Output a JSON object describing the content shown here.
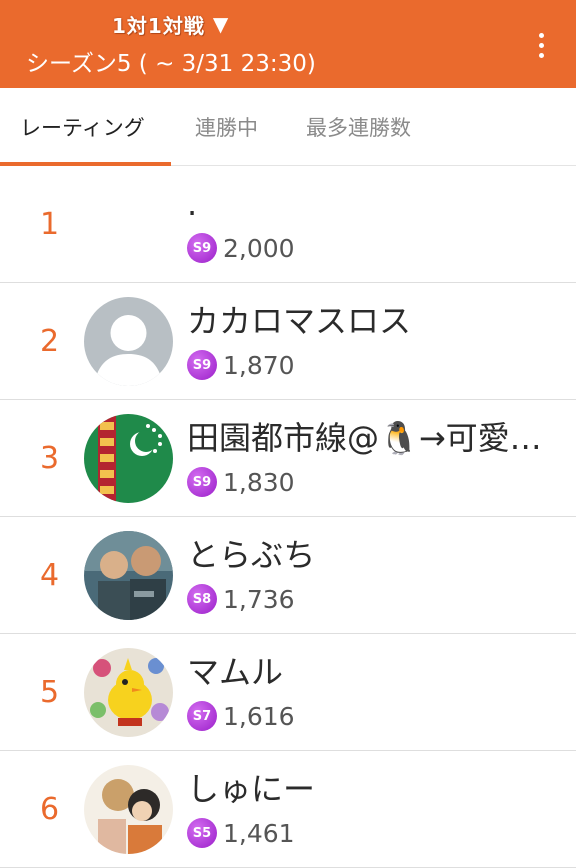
{
  "header": {
    "mode_label": "1対1対戦",
    "mode_caret": "▼",
    "season_label": "シーズン5 ( ~ 3/31 23:30)"
  },
  "tabs": [
    {
      "label": "レーティング",
      "active": true
    },
    {
      "label": "連勝中",
      "active": false
    },
    {
      "label": "最多連勝数",
      "active": false
    }
  ],
  "ranking": [
    {
      "rank": "1",
      "name": ".",
      "season_badge": "S9",
      "score": "2,000",
      "avatar": "none"
    },
    {
      "rank": "2",
      "name": "カカロマスロス",
      "season_badge": "S9",
      "score": "1,870",
      "avatar": "default-person"
    },
    {
      "rank": "3",
      "name": "田園都市線@🐧→可愛…",
      "season_badge": "S9",
      "score": "1,830",
      "avatar": "flag"
    },
    {
      "rank": "4",
      "name": "とらぶち",
      "season_badge": "S8",
      "score": "1,736",
      "avatar": "photo-two-men"
    },
    {
      "rank": "5",
      "name": "マムル",
      "season_badge": "S7",
      "score": "1,616",
      "avatar": "chocobo-illustration"
    },
    {
      "rank": "6",
      "name": "しゅにー",
      "season_badge": "S5",
      "score": "1,461",
      "avatar": "anime-illustration"
    }
  ],
  "colors": {
    "accent": "#ea6a2d",
    "badge": "#b93ce0"
  }
}
